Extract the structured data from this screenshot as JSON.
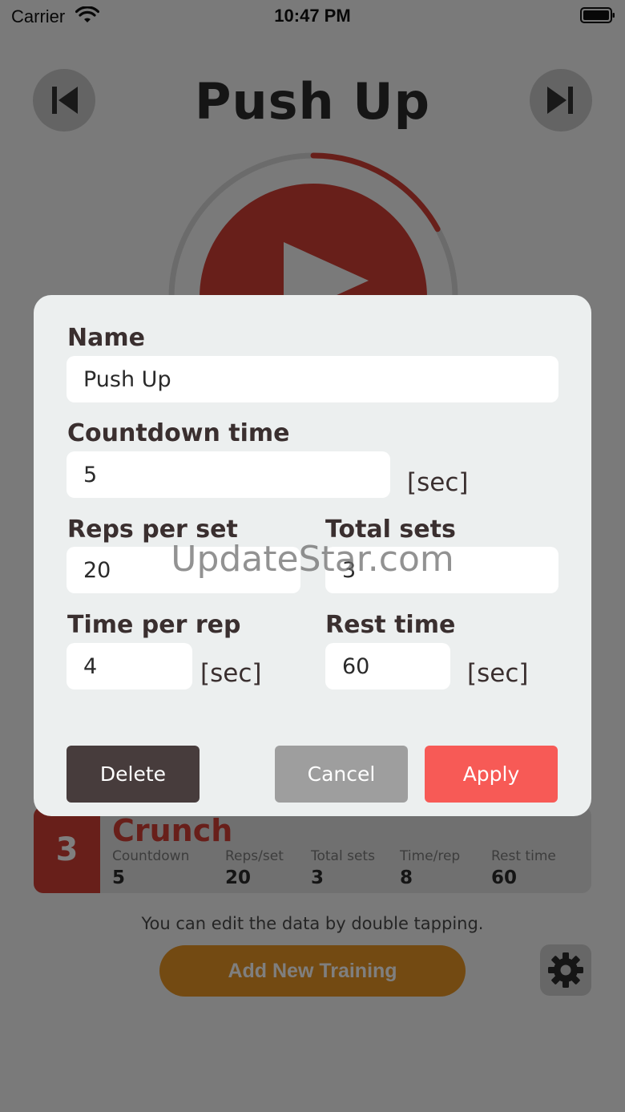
{
  "status_bar": {
    "carrier": "Carrier",
    "time": "10:47 PM",
    "icons": [
      "wifi-icon",
      "battery-icon"
    ]
  },
  "header": {
    "title": "Push Up",
    "prev_icon": "skip-previous-icon",
    "next_icon": "skip-next-icon"
  },
  "timer": {
    "progress": 0.17,
    "icon": "play-icon"
  },
  "workout_card": {
    "index": "3",
    "name": "Crunch",
    "stats": [
      {
        "label": "Countdown",
        "value": "5"
      },
      {
        "label": "Reps/set",
        "value": "20"
      },
      {
        "label": "Total sets",
        "value": "3"
      },
      {
        "label": "Time/rep",
        "value": "8"
      },
      {
        "label": "Rest time",
        "value": "60"
      }
    ]
  },
  "hint": "You can edit the data by double tapping.",
  "add_button": "Add New Training",
  "settings_icon": "gear-icon",
  "modal": {
    "name": {
      "label": "Name",
      "value": "Push Up"
    },
    "countdown": {
      "label": "Countdown time",
      "value": "5",
      "unit": "[sec]"
    },
    "reps": {
      "label": "Reps per set",
      "value": "20"
    },
    "sets": {
      "label": "Total sets",
      "value": "3"
    },
    "time_per_rep": {
      "label": "Time per rep",
      "value": "4",
      "unit": "[sec]"
    },
    "rest": {
      "label": "Rest time",
      "value": "60",
      "unit": "[sec]"
    },
    "buttons": {
      "delete": "Delete",
      "cancel": "Cancel",
      "apply": "Apply"
    }
  },
  "watermark": "UpdateStar.com",
  "colors": {
    "accent_red": "#d13f35",
    "apply_red": "#f75a56",
    "delete_dark": "#473c3c",
    "add_orange": "#e79424"
  }
}
